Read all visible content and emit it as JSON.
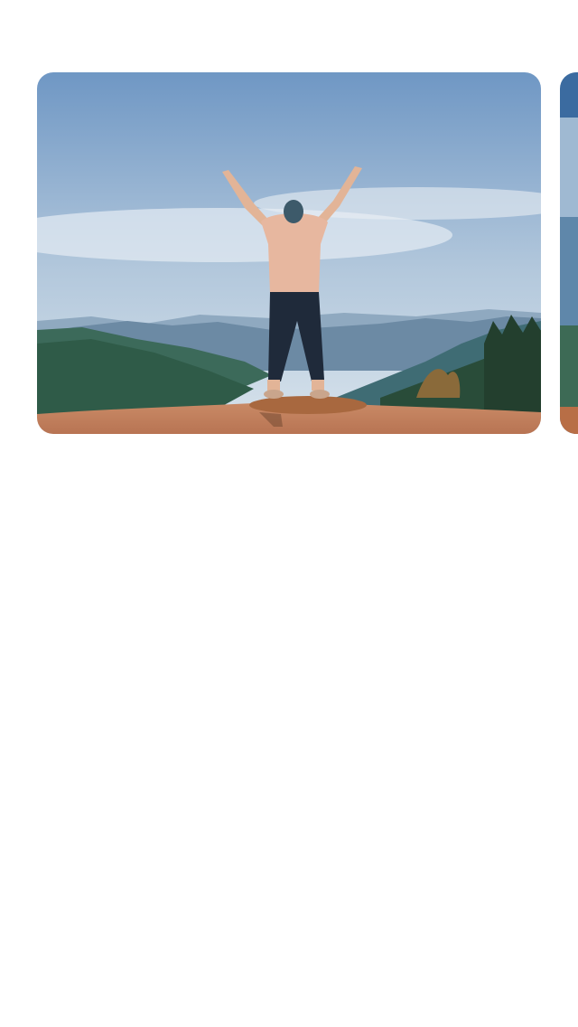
{
  "carousel": {
    "cards": [
      {
        "photo": "person-raising-arms-on-mountain-photo",
        "colors": {
          "sky_top": "#6f97c4",
          "sky_bottom": "#c7d8e6",
          "haze": "#dfe8ef",
          "mountains_far": "#7e9db8",
          "mountains_mid": "#4a7287",
          "hills": "#2f5b48",
          "trees": "#2a4b35",
          "ground": "#c98a66",
          "shirt": "#e7b79f",
          "pants": "#1f2a3a",
          "skin": "#e2b497"
        }
      },
      {
        "photo": "next-photo-peek"
      }
    ]
  }
}
